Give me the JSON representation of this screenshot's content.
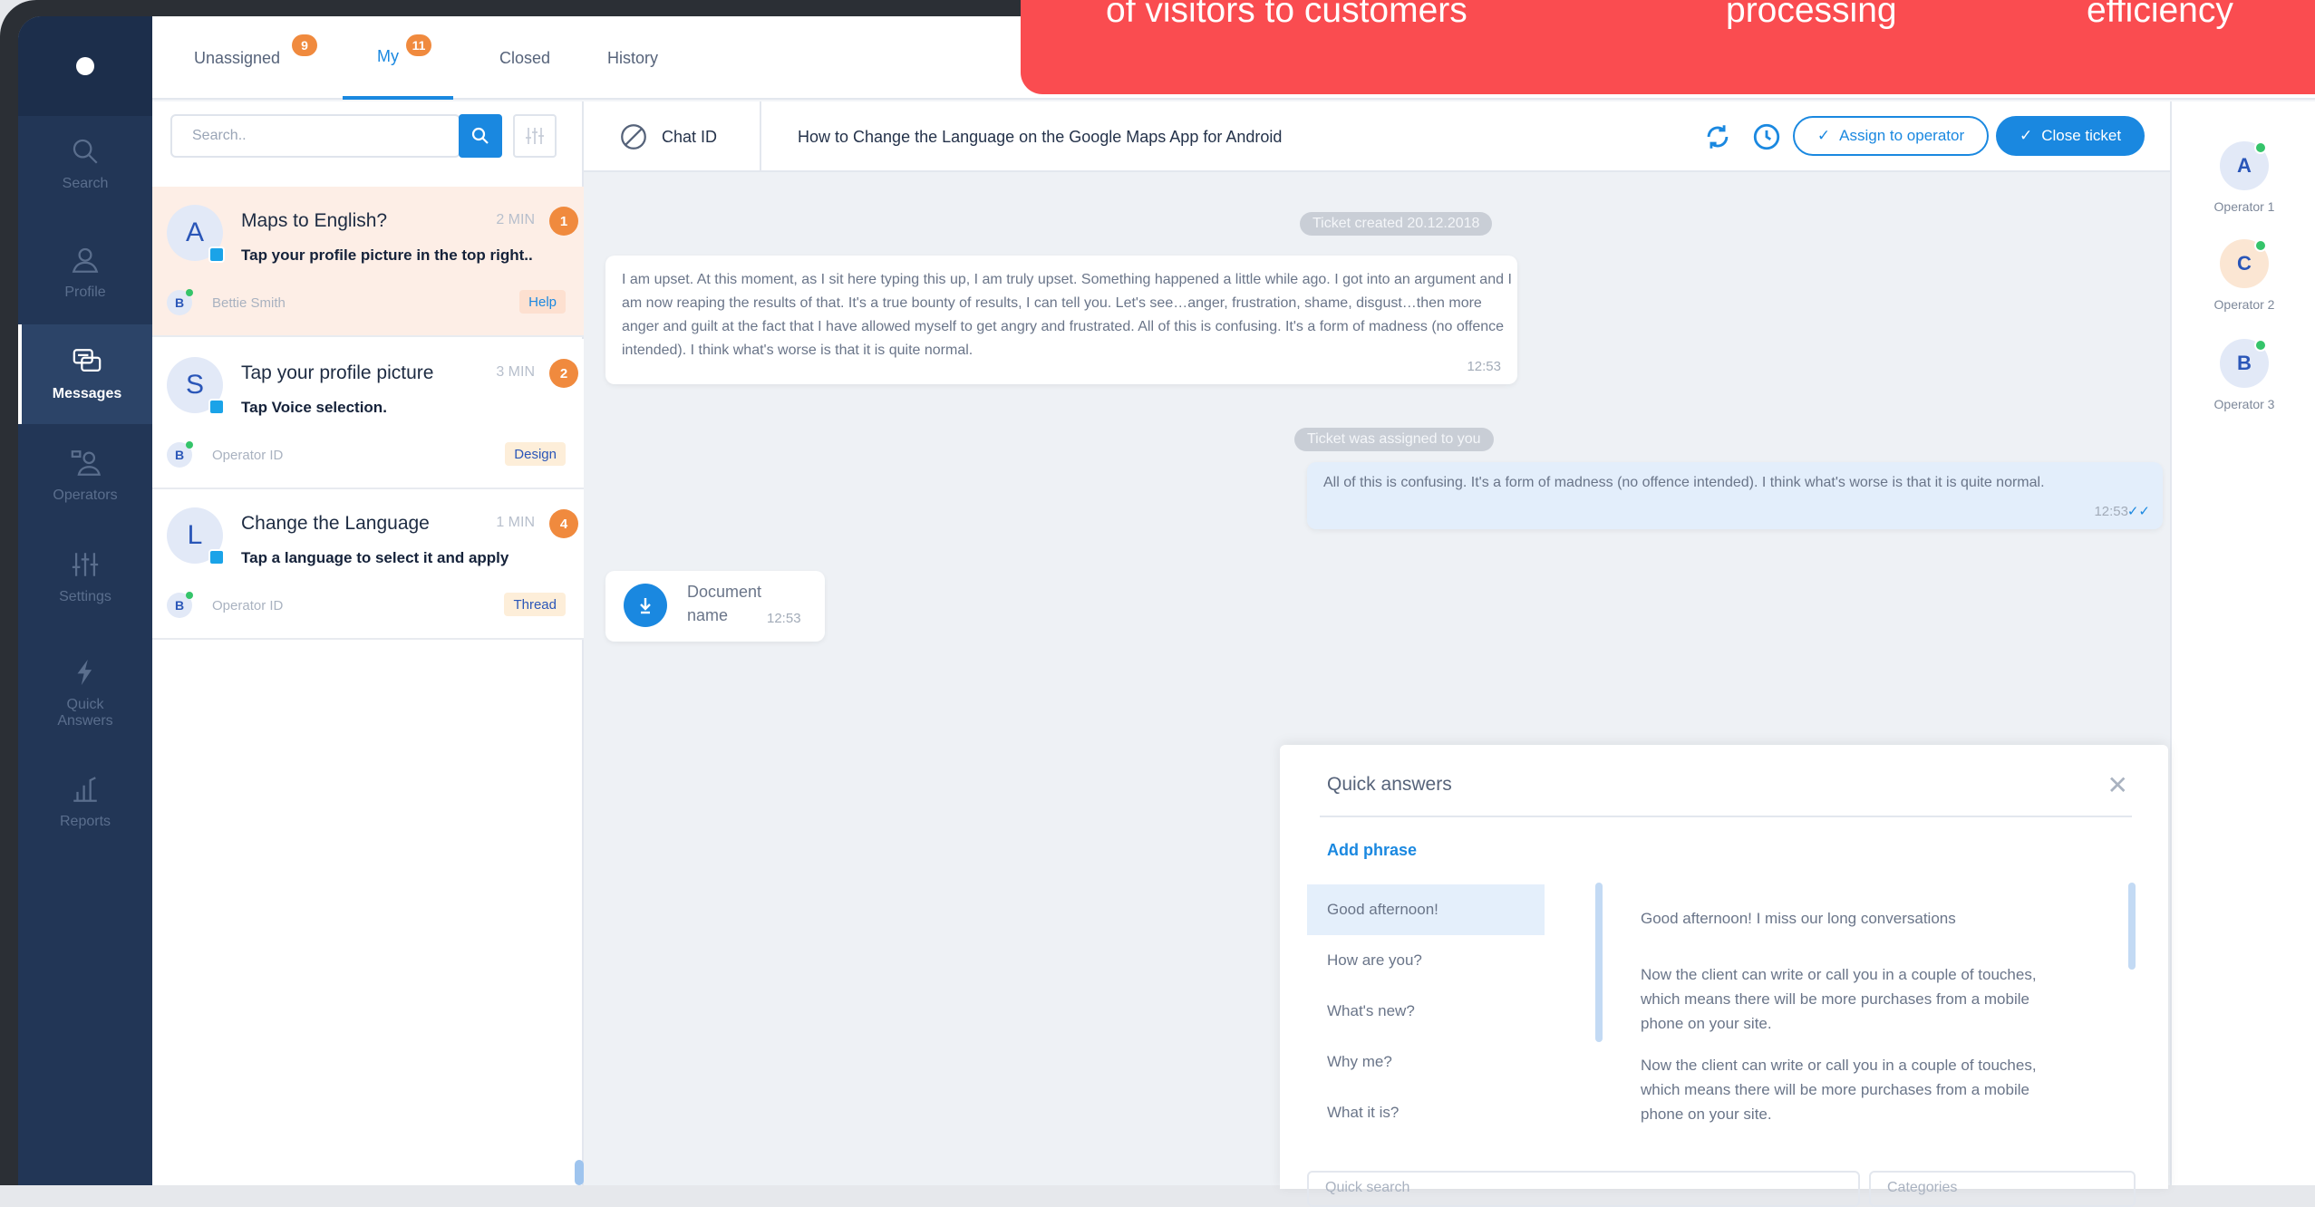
{
  "banner": {
    "texts": [
      "of visitors to customers",
      "processing",
      "efficiency"
    ]
  },
  "nav": {
    "items": [
      {
        "label": "Search",
        "icon": "search-icon"
      },
      {
        "label": "Profile",
        "icon": "profile-icon"
      },
      {
        "label": "Messages",
        "icon": "messages-icon",
        "active": true
      },
      {
        "label": "Operators",
        "icon": "operators-icon"
      },
      {
        "label": "Settings",
        "icon": "settings-icon"
      },
      {
        "label": "Quick Answers",
        "icon": "lightning-icon"
      },
      {
        "label": "Reports",
        "icon": "reports-icon"
      }
    ]
  },
  "tabs": [
    {
      "label": "Unassigned",
      "count": "9"
    },
    {
      "label": "My",
      "count": "11",
      "active": true
    },
    {
      "label": "Closed",
      "count": ""
    },
    {
      "label": "History",
      "count": ""
    }
  ],
  "search": {
    "placeholder": "Search.."
  },
  "tickets": [
    {
      "avatar": "A",
      "title": "Maps to English?",
      "time": "2 MIN",
      "count": "1",
      "preview": "Tap your profile picture in the top right..",
      "operator_initial": "B",
      "operator": "Bettie Smith",
      "tag": "Help",
      "tag_color": "#1a88e0",
      "tag_bg": "#fde0d0"
    },
    {
      "avatar": "S",
      "title": "Tap your profile picture",
      "time": "3 MIN",
      "count": "2",
      "preview": "Tap Voice selection.",
      "operator_initial": "B",
      "operator": "Operator ID",
      "tag": "Design",
      "tag_color": "#2a56b8",
      "tag_bg": "#fdeed9"
    },
    {
      "avatar": "L",
      "title": "Change the Language",
      "time": "1 MIN",
      "count": "4",
      "preview": "Tap a language to select it and apply",
      "operator_initial": "B",
      "operator": "Operator ID",
      "tag": "Thread",
      "tag_color": "#2a56b8",
      "tag_bg": "#fdeed9"
    }
  ],
  "chat": {
    "id_label": "Chat ID",
    "subject": "How to Change the Language on the Google Maps App for Android",
    "assign_label": "Assign to operator",
    "close_label": "Close ticket",
    "created_note": "Ticket created 20.12.2018",
    "assigned_note": "Ticket was assigned to you",
    "incoming_text": "I am upset. At this moment, as I sit here typing this up, I am truly upset. Something happened a little while ago. I got into an argument and I am now reaping the results of that. It's a true bounty of results, I can tell you. Let's see…anger, frustration, shame, disgust…then more anger and guilt at the fact that I have allowed myself to get angry and frustrated. All of this is confusing. It's a form of madness (no offence intended). I think what's worse is that it is quite normal.",
    "incoming_time": "12:53",
    "outgoing_text": "All of this is confusing. It's a form of madness (no offence intended). I think what's worse is that it is quite normal.",
    "outgoing_time": "12:53",
    "document_name": "Document name",
    "document_time": "12:53"
  },
  "quick_answers": {
    "title": "Quick answers",
    "add_label": "Add phrase",
    "phrases": [
      "Good afternoon!",
      "How are you?",
      "What's new?",
      "Why me?",
      "What it is?"
    ],
    "answers": [
      "Good afternoon! I miss our long conversations",
      "Now the client can write or call you in a couple of touches, which means there will be more purchases from a mobile phone on your site.",
      "Now the client can write or call you in a couple of touches, which means there will be more purchases from a mobile phone on your site."
    ],
    "search_placeholder": "Quick search",
    "categories_placeholder": "Categories"
  },
  "operators": [
    {
      "initial": "A",
      "name": "Operator 1",
      "bg": "#e2e9f7"
    },
    {
      "initial": "C",
      "name": "Operator 2",
      "bg": "#fbe6d3"
    },
    {
      "initial": "B",
      "name": "Operator 3",
      "bg": "#e2e9f7"
    }
  ],
  "colors": {
    "accent": "#1a88e0",
    "nav": "#223656",
    "banner": "#fa4c50",
    "badge": "#f08a3e"
  }
}
